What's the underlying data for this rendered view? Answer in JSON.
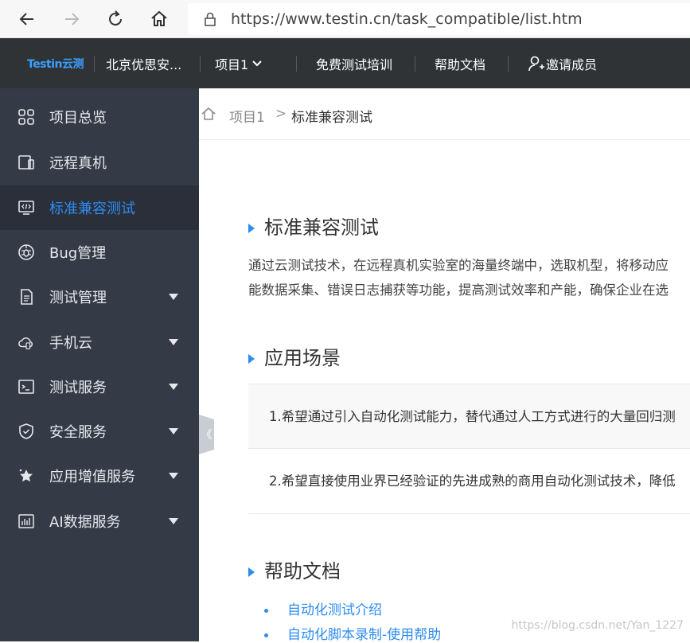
{
  "browser": {
    "url": "https://www.testin.cn/task_compatible/list.htm"
  },
  "top_nav": {
    "logo": "Testin云测",
    "org": "北京优思安...",
    "project": "项目1",
    "training": "免费测试培训",
    "help_docs": "帮助文档",
    "invite": "邀请成员"
  },
  "sidebar": {
    "items": [
      {
        "label": "项目总览",
        "icon": "grid-icon"
      },
      {
        "label": "远程真机",
        "icon": "device-icon"
      },
      {
        "label": "标准兼容测试",
        "icon": "code-monitor-icon",
        "active": true
      },
      {
        "label": "Bug管理",
        "icon": "bug-icon"
      },
      {
        "label": "测试管理",
        "icon": "document-icon",
        "expandable": true
      },
      {
        "label": "手机云",
        "icon": "cloud-icon",
        "expandable": true
      },
      {
        "label": "测试服务",
        "icon": "terminal-icon",
        "expandable": true
      },
      {
        "label": "安全服务",
        "icon": "shield-icon",
        "expandable": true
      },
      {
        "label": "应用增值服务",
        "icon": "star-icon",
        "expandable": true
      },
      {
        "label": "AI数据服务",
        "icon": "chart-icon",
        "expandable": true
      }
    ],
    "collapse_glyph": "《"
  },
  "breadcrumb": {
    "project": "项目1",
    "separator": ">",
    "current": "标准兼容测试"
  },
  "content": {
    "section1_title": "标准兼容测试",
    "desc_line1": "通过云测试技术，在远程真机实验室的海量终端中，选取机型，将移动应",
    "desc_line2": "能数据采集、错误日志捕获等功能，提高测试效率和产能，确保企业在选",
    "section2_title": "应用场景",
    "scenario1": "1.希望通过引入自动化测试能力，替代通过人工方式进行的大量回归测",
    "scenario2": "2.希望直接使用业界已经验证的先进成熟的商用自动化测试技术，降低",
    "section3_title": "帮助文档",
    "help_link1": "自动化测试介绍",
    "help_link2": "自动化脚本录制-使用帮助"
  },
  "watermark": "https://blog.csdn.net/Yan_1227",
  "colors": {
    "accent": "#2d8cf0",
    "sidebar_bg": "#353a47",
    "topnav_bg": "#2f3336"
  }
}
